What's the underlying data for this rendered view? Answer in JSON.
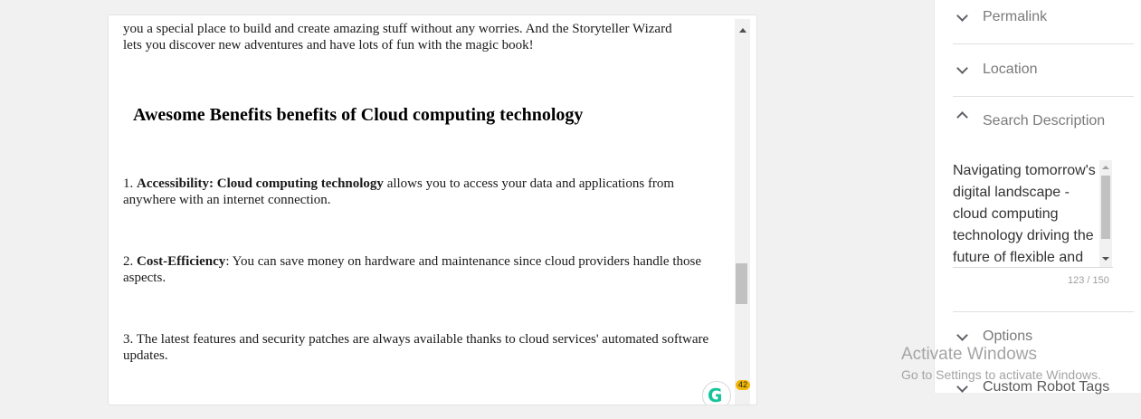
{
  "editor": {
    "intro_line1": "you a special place to build and create amazing stuff without any worries. And the Storyteller Wizard",
    "intro_line2": "lets you discover new adventures and have lots of fun with the magic book!",
    "heading": "Awesome Benefits benefits of Cloud computing technology",
    "items": [
      {
        "number": "1.",
        "bold": "Accessibility: Cloud computing technology",
        "rest": " allows you to access your data and applications from anywhere with an internet connection."
      },
      {
        "number": "2.",
        "bold": "Cost-Efficiency",
        "rest": ": You can save money on hardware and maintenance since cloud providers handle those aspects."
      },
      {
        "number": "3.",
        "bold": "",
        "rest": " The latest features and security patches are always available thanks to cloud services' automated software updates."
      }
    ],
    "grammarly_count": "42",
    "grammarly_icon": "grammarly-icon",
    "scroll_position": 0.6
  },
  "sidebar": {
    "sections": {
      "permalink": "Permalink",
      "location": "Location",
      "search_description": "Search Description",
      "options": "Options",
      "custom_robot_tags": "Custom Robot Tags"
    },
    "search_description_text": "Navigating tomorrow's digital landscape - cloud computing technology driving the future of flexible and",
    "char_counter": "123 / 150"
  },
  "watermark": {
    "title": "Activate Windows",
    "subtitle": "Go to Settings to activate Windows."
  }
}
